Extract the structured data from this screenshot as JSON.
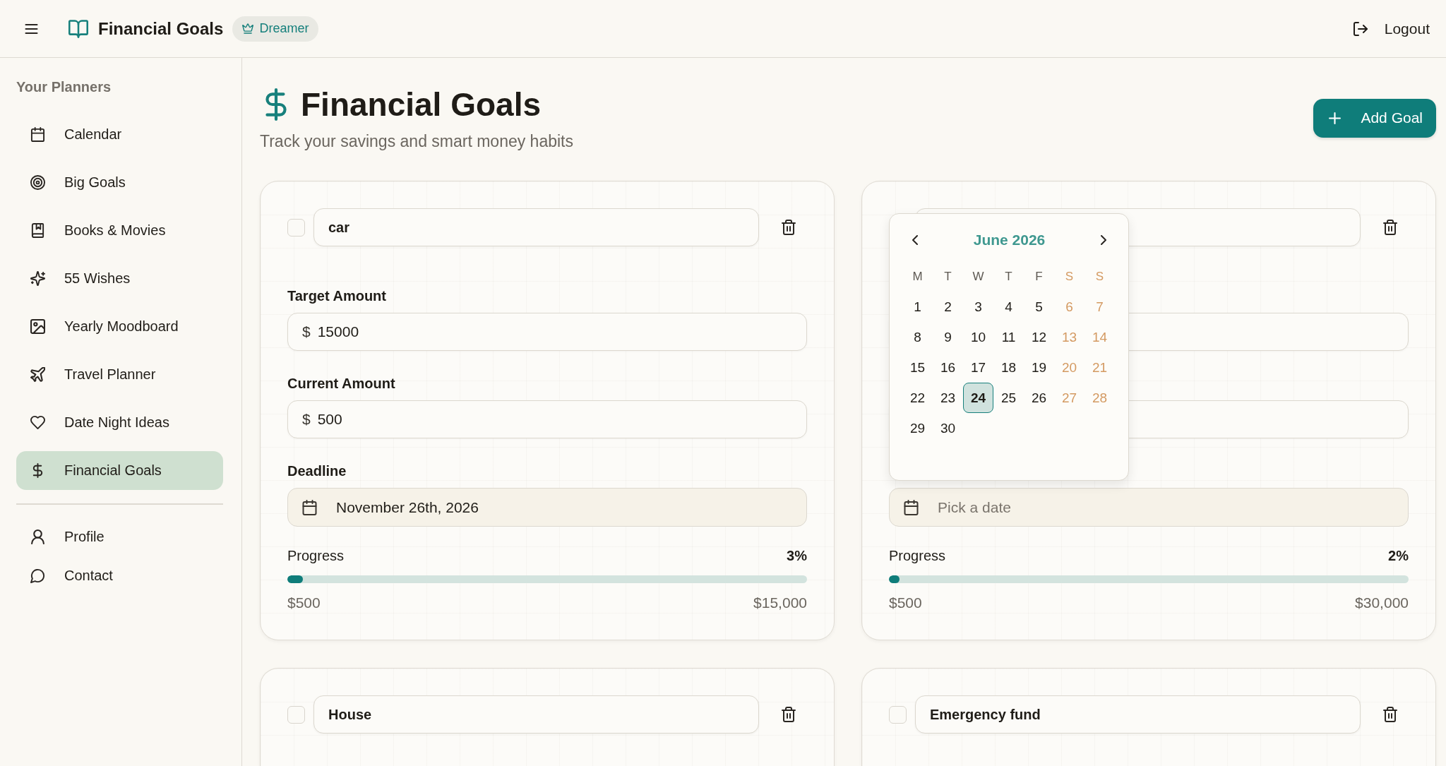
{
  "topbar": {
    "title": "Financial Goals",
    "badge": "Dreamer",
    "logout": "Logout"
  },
  "sidebar": {
    "heading": "Your Planners",
    "items": [
      {
        "label": "Calendar",
        "selected": false
      },
      {
        "label": "Big Goals",
        "selected": false
      },
      {
        "label": "Books & Movies",
        "selected": false
      },
      {
        "label": "55 Wishes",
        "selected": false
      },
      {
        "label": "Yearly Moodboard",
        "selected": false
      },
      {
        "label": "Travel Planner",
        "selected": false
      },
      {
        "label": "Date Night Ideas",
        "selected": false
      },
      {
        "label": "Financial Goals",
        "selected": true
      }
    ],
    "footer_items": [
      {
        "label": "Profile",
        "selected": false
      },
      {
        "label": "Contact",
        "selected": false
      }
    ]
  },
  "page": {
    "title": "Financial Goals",
    "subtitle": "Track your savings and smart money habits",
    "add_button": "Add Goal"
  },
  "goals": [
    {
      "name": "car",
      "checked": false,
      "fields": [
        {
          "kind": "amount",
          "label": "Target Amount",
          "prefix": "$",
          "value": "15000"
        },
        {
          "kind": "amount",
          "label": "Current Amount",
          "prefix": "$",
          "value": "500"
        }
      ],
      "deadline": {
        "label": "Deadline",
        "value": "November 26th, 2026"
      },
      "progress": {
        "label": "Progress",
        "percent": "3%",
        "level": 0.03,
        "current": "$500",
        "target": "$15,000"
      }
    },
    {
      "fields": [
        {
          "kind": "amount"
        },
        {
          "kind": "amount"
        }
      ],
      "deadline": {
        "placeholder": "Pick a date",
        "picker": {
          "month": "June 2026",
          "weekdays": [
            {
              "label": "M",
              "weekend": false
            },
            {
              "label": "T",
              "weekend": false
            },
            {
              "label": "W",
              "weekend": false
            },
            {
              "label": "T",
              "weekend": false
            },
            {
              "label": "F",
              "weekend": false
            },
            {
              "label": "S",
              "weekend": true
            },
            {
              "label": "S",
              "weekend": true
            }
          ],
          "days": [
            {
              "label": "1",
              "weekend": false,
              "selected": false
            },
            {
              "label": "2",
              "weekend": false,
              "selected": false
            },
            {
              "label": "3",
              "weekend": false,
              "selected": false
            },
            {
              "label": "4",
              "weekend": false,
              "selected": false
            },
            {
              "label": "5",
              "weekend": false,
              "selected": false
            },
            {
              "label": "6",
              "weekend": true,
              "selected": false
            },
            {
              "label": "7",
              "weekend": true,
              "selected": false
            },
            {
              "label": "8",
              "weekend": false,
              "selected": false
            },
            {
              "label": "9",
              "weekend": false,
              "selected": false
            },
            {
              "label": "10",
              "weekend": false,
              "selected": false
            },
            {
              "label": "11",
              "weekend": false,
              "selected": false
            },
            {
              "label": "12",
              "weekend": false,
              "selected": false
            },
            {
              "label": "13",
              "weekend": true,
              "selected": false
            },
            {
              "label": "14",
              "weekend": true,
              "selected": false
            },
            {
              "label": "15",
              "weekend": false,
              "selected": false
            },
            {
              "label": "16",
              "weekend": false,
              "selected": false
            },
            {
              "label": "17",
              "weekend": false,
              "selected": false
            },
            {
              "label": "18",
              "weekend": false,
              "selected": false
            },
            {
              "label": "19",
              "weekend": false,
              "selected": false
            },
            {
              "label": "20",
              "weekend": true,
              "selected": false
            },
            {
              "label": "21",
              "weekend": true,
              "selected": false
            },
            {
              "label": "22",
              "weekend": false,
              "selected": false
            },
            {
              "label": "23",
              "weekend": false,
              "selected": false
            },
            {
              "label": "24",
              "weekend": false,
              "selected": true
            },
            {
              "label": "25",
              "weekend": false,
              "selected": false
            },
            {
              "label": "26",
              "weekend": false,
              "selected": false
            },
            {
              "label": "27",
              "weekend": true,
              "selected": false
            },
            {
              "label": "28",
              "weekend": true,
              "selected": false
            },
            {
              "label": "29",
              "weekend": false,
              "selected": false
            },
            {
              "label": "30",
              "weekend": false,
              "selected": false
            }
          ]
        }
      },
      "progress": {
        "label": "Progress",
        "percent": "2%",
        "level": 0.02,
        "current": "$500",
        "target": "$30,000"
      }
    },
    {
      "name": "House",
      "checked": false
    },
    {
      "name": "Emergency fund",
      "checked": false
    }
  ]
}
